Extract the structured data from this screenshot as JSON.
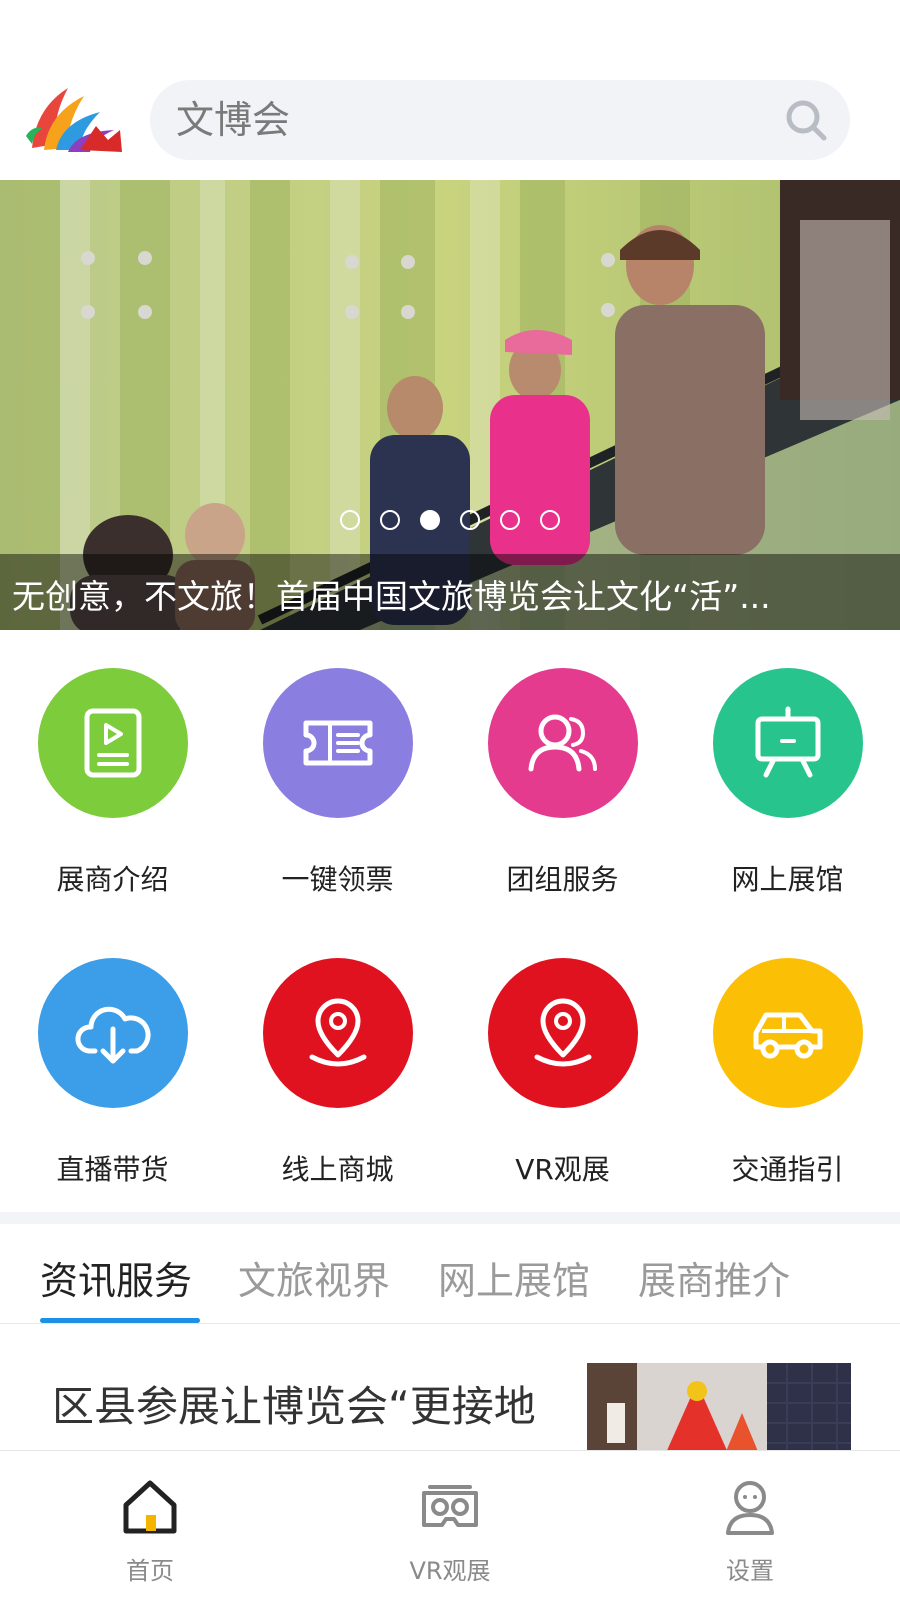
{
  "header": {
    "search_placeholder": "文博会",
    "search_icon": "search-icon",
    "logo": "app-logo"
  },
  "banner": {
    "caption": "无创意，不文旅！首届中国文旅博览会让文化“活”...",
    "slide_count": 6,
    "active_slide": 3
  },
  "services": [
    {
      "label": "展商介绍",
      "icon": "video-document-icon",
      "color": "#7ccc3c"
    },
    {
      "label": "一键领票",
      "icon": "ticket-icon",
      "color": "#8a7ee0"
    },
    {
      "label": "团组服务",
      "icon": "group-users-icon",
      "color": "#e43b8f"
    },
    {
      "label": "网上展馆",
      "icon": "easel-board-icon",
      "color": "#27c48e"
    },
    {
      "label": "直播带货",
      "icon": "cloud-download-icon",
      "color": "#3c9ee8"
    },
    {
      "label": "线上商城",
      "icon": "location-pin-icon",
      "color": "#e0121f"
    },
    {
      "label": "VR观展",
      "icon": "location-pin-icon",
      "color": "#e0121f"
    },
    {
      "label": "交通指引",
      "icon": "car-icon",
      "color": "#fbbf06"
    }
  ],
  "tabs": [
    {
      "label": "资讯服务",
      "active": true
    },
    {
      "label": "文旅视界",
      "active": false
    },
    {
      "label": "网上展馆",
      "active": false
    },
    {
      "label": "展商推介",
      "active": false
    }
  ],
  "accent_color": "#1e90e6",
  "news": [
    {
      "title": "区县参展让博览会“更接地"
    }
  ],
  "bottom_nav": [
    {
      "label": "首页",
      "icon": "home-icon",
      "active": true
    },
    {
      "label": "VR观展",
      "icon": "vr-headset-icon",
      "active": false
    },
    {
      "label": "设置",
      "icon": "user-settings-icon",
      "active": false
    }
  ]
}
